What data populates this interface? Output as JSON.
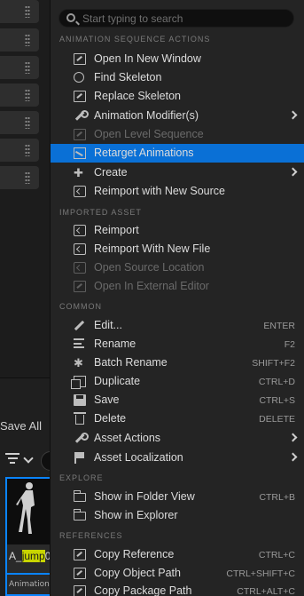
{
  "background": {
    "save_all_label": "Save All",
    "asset_name_prefix": "A_",
    "asset_name_highlight": "jump",
    "asset_name_suffix": "0",
    "asset_type_label": "Animation S"
  },
  "search": {
    "placeholder": "Start typing to search"
  },
  "sections": {
    "animation_sequence_actions": "ANIMATION SEQUENCE ACTIONS",
    "imported_asset": "IMPORTED ASSET",
    "common": "COMMON",
    "explore": "EXPLORE",
    "references": "REFERENCES"
  },
  "items": {
    "open_in_new_window": {
      "label": "Open In New Window"
    },
    "find_skeleton": {
      "label": "Find Skeleton"
    },
    "replace_skeleton": {
      "label": "Replace Skeleton"
    },
    "animation_modifiers": {
      "label": "Animation Modifier(s)"
    },
    "open_level_sequence": {
      "label": "Open Level Sequence"
    },
    "retarget_animations": {
      "label": "Retarget Animations"
    },
    "create": {
      "label": "Create"
    },
    "reimport_new_source": {
      "label": "Reimport with New Source"
    },
    "reimport": {
      "label": "Reimport"
    },
    "reimport_new_file": {
      "label": "Reimport With New File"
    },
    "open_source_location": {
      "label": "Open Source Location"
    },
    "open_external_editor": {
      "label": "Open In External Editor"
    },
    "edit": {
      "label": "Edit...",
      "shortcut": "ENTER"
    },
    "rename": {
      "label": "Rename",
      "shortcut": "F2"
    },
    "batch_rename": {
      "label": "Batch Rename",
      "shortcut": "SHIFT+F2"
    },
    "duplicate": {
      "label": "Duplicate",
      "shortcut": "CTRL+D"
    },
    "save": {
      "label": "Save",
      "shortcut": "CTRL+S"
    },
    "delete": {
      "label": "Delete",
      "shortcut": "DELETE"
    },
    "asset_actions": {
      "label": "Asset Actions"
    },
    "asset_localization": {
      "label": "Asset Localization"
    },
    "show_in_folder_view": {
      "label": "Show in Folder View",
      "shortcut": "CTRL+B"
    },
    "show_in_explorer": {
      "label": "Show in Explorer"
    },
    "copy_reference": {
      "label": "Copy Reference",
      "shortcut": "CTRL+C"
    },
    "copy_object_path": {
      "label": "Copy Object Path",
      "shortcut": "CTRL+SHIFT+C"
    },
    "copy_package_path": {
      "label": "Copy Package Path",
      "shortcut": "CTRL+ALT+C"
    }
  },
  "colors": {
    "selection": "#0a70d6",
    "menu_bg": "#242424",
    "highlight": "#c8d400"
  }
}
